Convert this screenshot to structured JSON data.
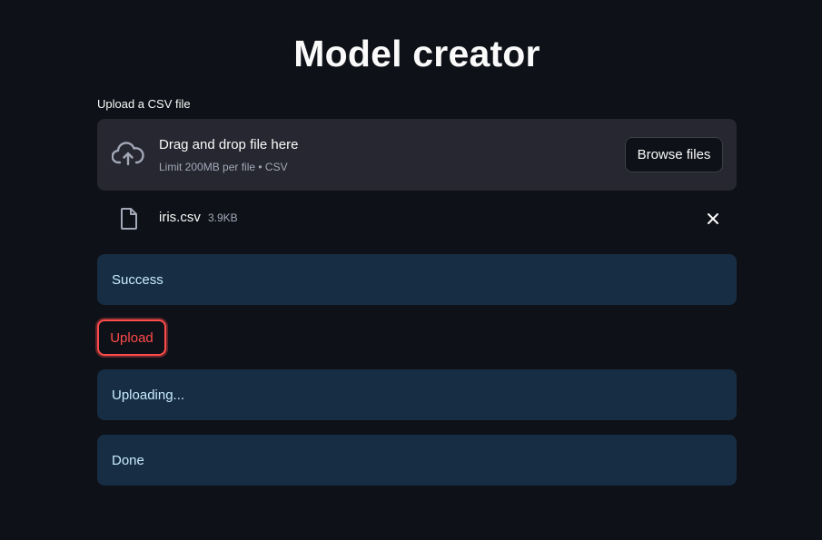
{
  "page": {
    "title": "Model creator"
  },
  "uploader": {
    "label": "Upload a CSV file",
    "dropzone_title": "Drag and drop file here",
    "dropzone_limit": "Limit 200MB per file • CSV",
    "browse_label": "Browse files",
    "file": {
      "name": "iris.csv",
      "size": "3.9KB"
    }
  },
  "alerts": {
    "success": "Success",
    "uploading": "Uploading...",
    "done": "Done"
  },
  "actions": {
    "upload_label": "Upload"
  },
  "colors": {
    "background": "#0e1117",
    "dropzone": "#262730",
    "alert_bg": "#172d43",
    "alert_text": "#c7ebff",
    "accent": "#ff4b4b"
  },
  "icons": {
    "dropzone": "cloud-upload-icon",
    "file": "file-icon",
    "remove": "close-icon"
  }
}
